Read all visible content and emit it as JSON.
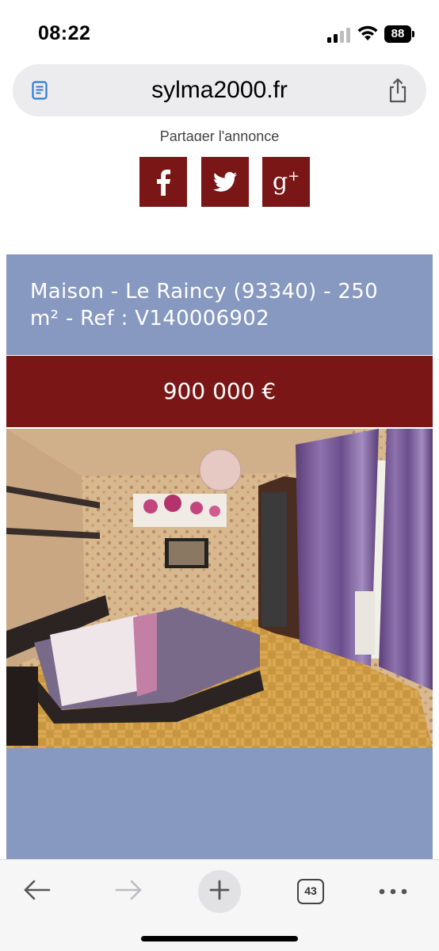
{
  "status_bar": {
    "time": "08:22",
    "battery": "88",
    "icons": [
      "cellular-signal-icon",
      "wifi-icon",
      "battery-icon"
    ]
  },
  "browser": {
    "url": "sylma2000.fr",
    "icons": [
      "reader-icon",
      "share-icon"
    ]
  },
  "page": {
    "share_label": "Partager l'annonce",
    "social": [
      {
        "name": "facebook",
        "icon": "facebook-icon"
      },
      {
        "name": "twitter",
        "icon": "twitter-icon"
      },
      {
        "name": "google-plus",
        "icon": "google-plus-icon",
        "glyph": "g+"
      }
    ],
    "listing_title": "Maison - Le Raincy (93340) - 250 m² - Ref : V140006902",
    "price": "900 000 €",
    "photo": "bedroom-photo"
  },
  "toolbar": {
    "tab_count": "43",
    "icons": [
      "back-arrow-icon",
      "forward-arrow-icon",
      "plus-icon",
      "tabs-icon",
      "more-icon"
    ]
  },
  "colors": {
    "brand_red": "#7a1716",
    "header_blue": "#8799c0",
    "url_bar_bg": "#ececef",
    "toolbar_bg": "#f6f6f7"
  }
}
